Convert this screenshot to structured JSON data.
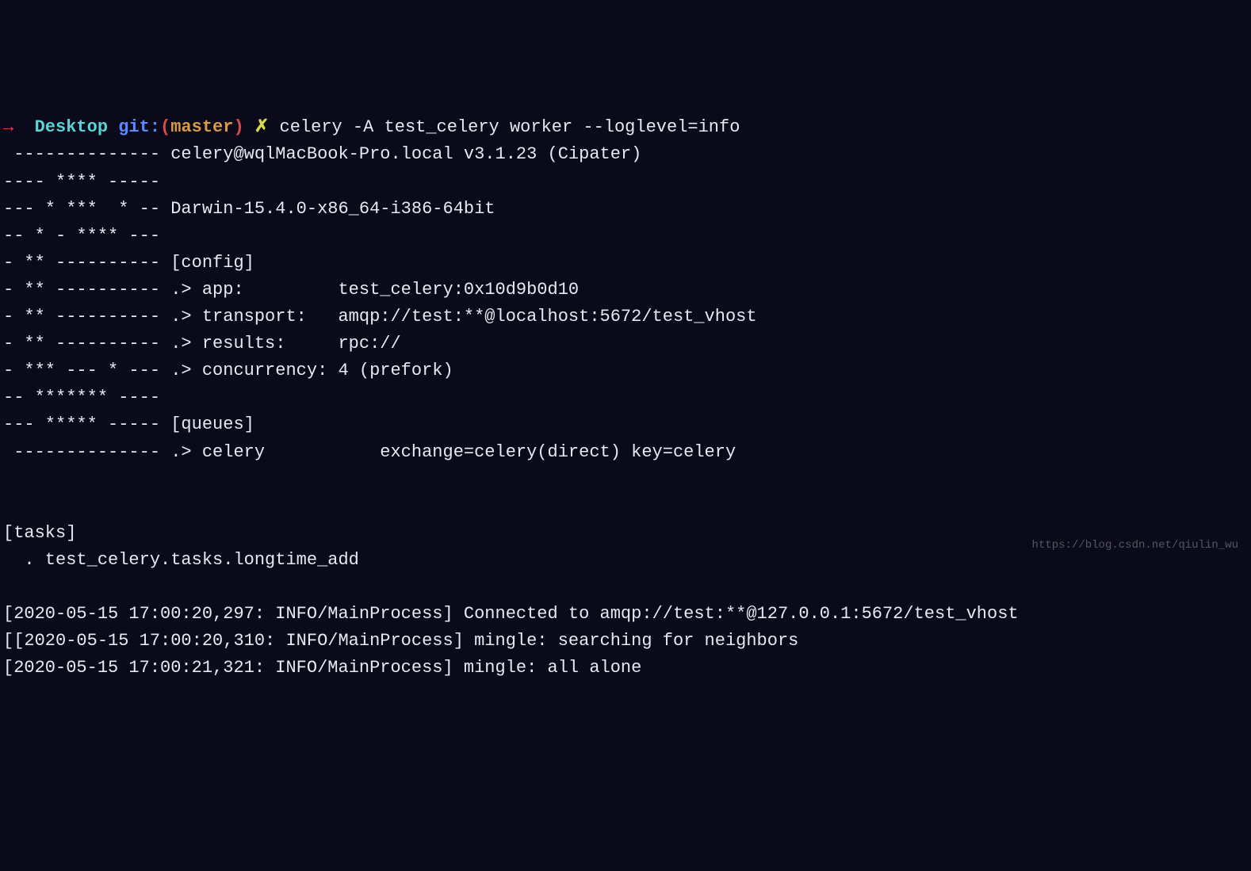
{
  "prompt": {
    "arrow": "→",
    "desktop": "Desktop",
    "git": "git",
    "colon": ":",
    "open_paren": "(",
    "branch": "master",
    "close_paren": ")",
    "xmark": "✗",
    "command": "celery -A test_celery worker --loglevel=info"
  },
  "banner": {
    "line01": " -------------- celery@wqlMacBook-Pro.local v3.1.23 (Cipater)",
    "line02": "---- **** -----",
    "line03": "--- * ***  * -- Darwin-15.4.0-x86_64-i386-64bit",
    "line04": "-- * - **** ---",
    "line05": "- ** ---------- [config]",
    "line06": "- ** ---------- .> app:         test_celery:0x10d9b0d10",
    "line07": "- ** ---------- .> transport:   amqp://test:**@localhost:5672/test_vhost",
    "line08": "- ** ---------- .> results:     rpc://",
    "line09": "- *** --- * --- .> concurrency: 4 (prefork)",
    "line10": "-- ******* ----",
    "line11": "--- ***** ----- [queues]",
    "line12": " -------------- .> celery           exchange=celery(direct) key=celery",
    "line13": "                ",
    "line14": "",
    "line15": "[tasks]",
    "line16": "  . test_celery.tasks.longtime_add",
    "line17": "",
    "line18": "[2020-05-15 17:00:20,297: INFO/MainProcess] Connected to amqp://test:**@127.0.0.1:5672/test_vhost",
    "line19": "[[2020-05-15 17:00:20,310: INFO/MainProcess] mingle: searching for neighbors",
    "line20": "[2020-05-15 17:00:21,321: INFO/MainProcess] mingle: all alone"
  },
  "watermark": "https://blog.csdn.net/qiulin_wu"
}
